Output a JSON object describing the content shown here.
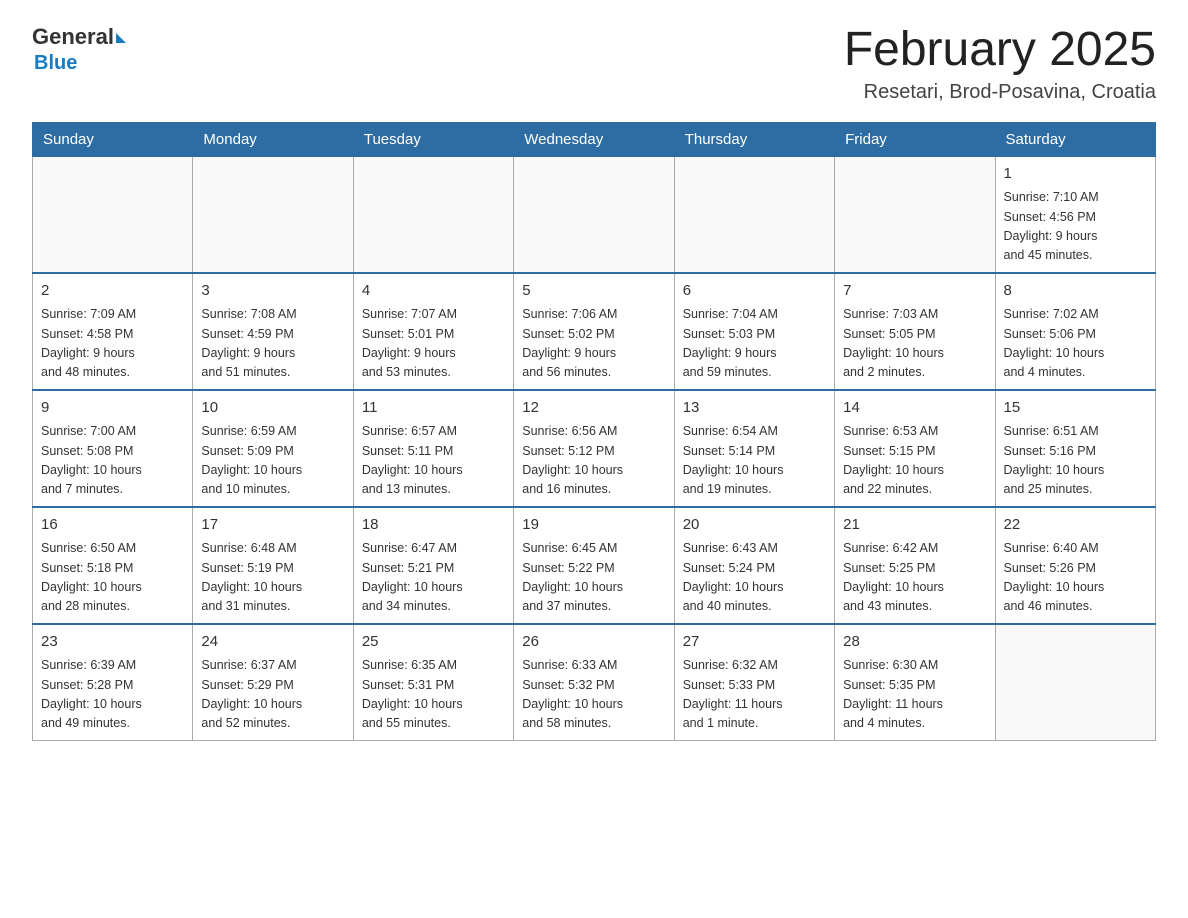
{
  "logo": {
    "general": "General",
    "blue": "Blue"
  },
  "header": {
    "title": "February 2025",
    "location": "Resetari, Brod-Posavina, Croatia"
  },
  "weekdays": [
    "Sunday",
    "Monday",
    "Tuesday",
    "Wednesday",
    "Thursday",
    "Friday",
    "Saturday"
  ],
  "weeks": [
    [
      {
        "day": "",
        "info": ""
      },
      {
        "day": "",
        "info": ""
      },
      {
        "day": "",
        "info": ""
      },
      {
        "day": "",
        "info": ""
      },
      {
        "day": "",
        "info": ""
      },
      {
        "day": "",
        "info": ""
      },
      {
        "day": "1",
        "info": "Sunrise: 7:10 AM\nSunset: 4:56 PM\nDaylight: 9 hours\nand 45 minutes."
      }
    ],
    [
      {
        "day": "2",
        "info": "Sunrise: 7:09 AM\nSunset: 4:58 PM\nDaylight: 9 hours\nand 48 minutes."
      },
      {
        "day": "3",
        "info": "Sunrise: 7:08 AM\nSunset: 4:59 PM\nDaylight: 9 hours\nand 51 minutes."
      },
      {
        "day": "4",
        "info": "Sunrise: 7:07 AM\nSunset: 5:01 PM\nDaylight: 9 hours\nand 53 minutes."
      },
      {
        "day": "5",
        "info": "Sunrise: 7:06 AM\nSunset: 5:02 PM\nDaylight: 9 hours\nand 56 minutes."
      },
      {
        "day": "6",
        "info": "Sunrise: 7:04 AM\nSunset: 5:03 PM\nDaylight: 9 hours\nand 59 minutes."
      },
      {
        "day": "7",
        "info": "Sunrise: 7:03 AM\nSunset: 5:05 PM\nDaylight: 10 hours\nand 2 minutes."
      },
      {
        "day": "8",
        "info": "Sunrise: 7:02 AM\nSunset: 5:06 PM\nDaylight: 10 hours\nand 4 minutes."
      }
    ],
    [
      {
        "day": "9",
        "info": "Sunrise: 7:00 AM\nSunset: 5:08 PM\nDaylight: 10 hours\nand 7 minutes."
      },
      {
        "day": "10",
        "info": "Sunrise: 6:59 AM\nSunset: 5:09 PM\nDaylight: 10 hours\nand 10 minutes."
      },
      {
        "day": "11",
        "info": "Sunrise: 6:57 AM\nSunset: 5:11 PM\nDaylight: 10 hours\nand 13 minutes."
      },
      {
        "day": "12",
        "info": "Sunrise: 6:56 AM\nSunset: 5:12 PM\nDaylight: 10 hours\nand 16 minutes."
      },
      {
        "day": "13",
        "info": "Sunrise: 6:54 AM\nSunset: 5:14 PM\nDaylight: 10 hours\nand 19 minutes."
      },
      {
        "day": "14",
        "info": "Sunrise: 6:53 AM\nSunset: 5:15 PM\nDaylight: 10 hours\nand 22 minutes."
      },
      {
        "day": "15",
        "info": "Sunrise: 6:51 AM\nSunset: 5:16 PM\nDaylight: 10 hours\nand 25 minutes."
      }
    ],
    [
      {
        "day": "16",
        "info": "Sunrise: 6:50 AM\nSunset: 5:18 PM\nDaylight: 10 hours\nand 28 minutes."
      },
      {
        "day": "17",
        "info": "Sunrise: 6:48 AM\nSunset: 5:19 PM\nDaylight: 10 hours\nand 31 minutes."
      },
      {
        "day": "18",
        "info": "Sunrise: 6:47 AM\nSunset: 5:21 PM\nDaylight: 10 hours\nand 34 minutes."
      },
      {
        "day": "19",
        "info": "Sunrise: 6:45 AM\nSunset: 5:22 PM\nDaylight: 10 hours\nand 37 minutes."
      },
      {
        "day": "20",
        "info": "Sunrise: 6:43 AM\nSunset: 5:24 PM\nDaylight: 10 hours\nand 40 minutes."
      },
      {
        "day": "21",
        "info": "Sunrise: 6:42 AM\nSunset: 5:25 PM\nDaylight: 10 hours\nand 43 minutes."
      },
      {
        "day": "22",
        "info": "Sunrise: 6:40 AM\nSunset: 5:26 PM\nDaylight: 10 hours\nand 46 minutes."
      }
    ],
    [
      {
        "day": "23",
        "info": "Sunrise: 6:39 AM\nSunset: 5:28 PM\nDaylight: 10 hours\nand 49 minutes."
      },
      {
        "day": "24",
        "info": "Sunrise: 6:37 AM\nSunset: 5:29 PM\nDaylight: 10 hours\nand 52 minutes."
      },
      {
        "day": "25",
        "info": "Sunrise: 6:35 AM\nSunset: 5:31 PM\nDaylight: 10 hours\nand 55 minutes."
      },
      {
        "day": "26",
        "info": "Sunrise: 6:33 AM\nSunset: 5:32 PM\nDaylight: 10 hours\nand 58 minutes."
      },
      {
        "day": "27",
        "info": "Sunrise: 6:32 AM\nSunset: 5:33 PM\nDaylight: 11 hours\nand 1 minute."
      },
      {
        "day": "28",
        "info": "Sunrise: 6:30 AM\nSunset: 5:35 PM\nDaylight: 11 hours\nand 4 minutes."
      },
      {
        "day": "",
        "info": ""
      }
    ]
  ]
}
